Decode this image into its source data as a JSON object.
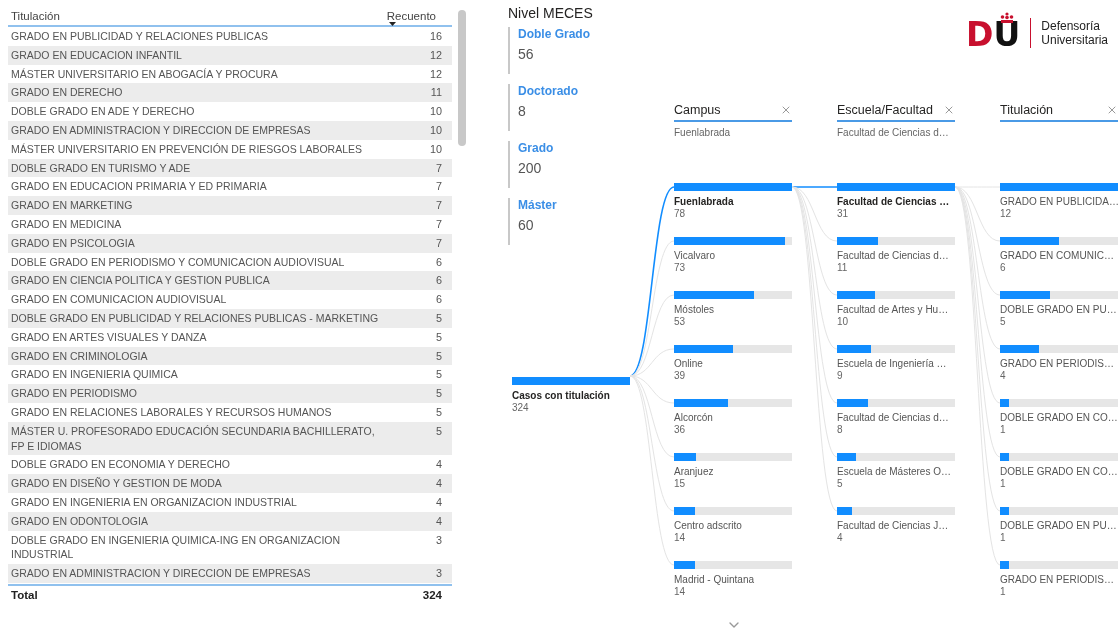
{
  "table": {
    "columns": [
      {
        "label": "Titulación",
        "sorted": false
      },
      {
        "label": "Recuento",
        "sorted": true
      }
    ],
    "rows": [
      {
        "title": "GRADO EN PUBLICIDAD Y RELACIONES PUBLICAS",
        "count": "16"
      },
      {
        "title": "GRADO EN EDUCACION INFANTIL",
        "count": "12"
      },
      {
        "title": "MÁSTER UNIVERSITARIO EN ABOGACÍA Y PROCURA",
        "count": "12"
      },
      {
        "title": "GRADO EN DERECHO",
        "count": "11"
      },
      {
        "title": "DOBLE GRADO EN ADE Y DERECHO",
        "count": "10"
      },
      {
        "title": "GRADO EN ADMINISTRACION Y DIRECCION DE EMPRESAS",
        "count": "10"
      },
      {
        "title": "MÁSTER UNIVERSITARIO EN PREVENCIÓN DE RIESGOS LABORALES",
        "count": "10"
      },
      {
        "title": "DOBLE GRADO EN TURISMO Y ADE",
        "count": "7"
      },
      {
        "title": "GRADO EN EDUCACION PRIMARIA Y ED PRIMARIA",
        "count": "7"
      },
      {
        "title": "GRADO EN MARKETING",
        "count": "7"
      },
      {
        "title": "GRADO EN MEDICINA",
        "count": "7"
      },
      {
        "title": "GRADO EN PSICOLOGIA",
        "count": "7"
      },
      {
        "title": "DOBLE GRADO EN PERIODISMO Y COMUNICACION AUDIOVISUAL",
        "count": "6"
      },
      {
        "title": "GRADO EN CIENCIA POLITICA Y GESTION PUBLICA",
        "count": "6"
      },
      {
        "title": "GRADO EN COMUNICACION AUDIOVISUAL",
        "count": "6"
      },
      {
        "title": "DOBLE GRADO EN PUBLICIDAD Y RELACIONES PUBLICAS - MARKETING",
        "count": "5"
      },
      {
        "title": "GRADO EN ARTES VISUALES Y DANZA",
        "count": "5"
      },
      {
        "title": "GRADO EN CRIMINOLOGIA",
        "count": "5"
      },
      {
        "title": "GRADO EN INGENIERIA QUIMICA",
        "count": "5"
      },
      {
        "title": "GRADO EN PERIODISMO",
        "count": "5"
      },
      {
        "title": "GRADO EN RELACIONES LABORALES Y RECURSOS HUMANOS",
        "count": "5"
      },
      {
        "title": "MÁSTER U. PROFESORADO EDUCACIÓN SECUNDARIA BACHILLERATO, FP E IDIOMAS",
        "count": "5"
      },
      {
        "title": "DOBLE GRADO EN ECONOMIA Y DERECHO",
        "count": "4"
      },
      {
        "title": "GRADO EN DISEÑO Y GESTION DE MODA",
        "count": "4"
      },
      {
        "title": "GRADO EN INGENIERIA EN ORGANIZACION INDUSTRIAL",
        "count": "4"
      },
      {
        "title": "GRADO EN ODONTOLOGIA",
        "count": "4"
      },
      {
        "title": "DOBLE GRADO EN INGENIERIA QUIMICA-ING EN ORGANIZACION INDUSTRIAL",
        "count": "3"
      },
      {
        "title": "GRADO EN ADMINISTRACION Y DIRECCION DE EMPRESAS",
        "count": "3"
      }
    ],
    "total": {
      "label": "Total",
      "value": "324"
    }
  },
  "meces": {
    "title": "Nivel MECES",
    "cards": [
      {
        "label": "Doble Grado",
        "value": "56"
      },
      {
        "label": "Doctorado",
        "value": "8"
      },
      {
        "label": "Grado",
        "value": "200"
      },
      {
        "label": "Máster",
        "value": "60"
      }
    ]
  },
  "logo": {
    "mark_left": "D",
    "mark_right": "U",
    "name_line1": "Defensoría",
    "name_line2": "Universitaria"
  },
  "tree": {
    "root": {
      "label": "Casos con titulación",
      "value": "324"
    },
    "columns": [
      {
        "header": "Campus",
        "filter": "Fuenlabrada",
        "nodes": [
          {
            "label": "Fuenlabrada",
            "value": "78",
            "level": 1,
            "selected": true
          },
          {
            "label": "Vicalvaro",
            "value": "73",
            "level": 0.94,
            "selected": false
          },
          {
            "label": "Móstoles",
            "value": "53",
            "level": 0.68,
            "selected": false
          },
          {
            "label": "Online",
            "value": "39",
            "level": 0.5,
            "selected": false
          },
          {
            "label": "Alcorcón",
            "value": "36",
            "level": 0.46,
            "selected": false
          },
          {
            "label": "Aranjuez",
            "value": "15",
            "level": 0.19,
            "selected": false
          },
          {
            "label": "Centro adscrito",
            "value": "14",
            "level": 0.18,
            "selected": false
          },
          {
            "label": "Madrid - Quintana",
            "value": "14",
            "level": 0.18,
            "selected": false
          }
        ]
      },
      {
        "header": "Escuela/Facultad",
        "filter": "Facultad de Ciencias d…",
        "nodes": [
          {
            "label": "Facultad de Ciencias …",
            "value": "31",
            "level": 1,
            "selected": true
          },
          {
            "label": "Facultad de Ciencias d…",
            "value": "11",
            "level": 0.35,
            "selected": false
          },
          {
            "label": "Facultad de Artes y Hu…",
            "value": "10",
            "level": 0.32,
            "selected": false
          },
          {
            "label": "Escuela de Ingeniería …",
            "value": "9",
            "level": 0.29,
            "selected": false
          },
          {
            "label": "Facultad de Ciencias d…",
            "value": "8",
            "level": 0.26,
            "selected": false
          },
          {
            "label": "Escuela de Másteres O…",
            "value": "5",
            "level": 0.16,
            "selected": false
          },
          {
            "label": "Facultad de Ciencias J…",
            "value": "4",
            "level": 0.13,
            "selected": false
          }
        ]
      },
      {
        "header": "Titulación",
        "nodes": [
          {
            "label": "GRADO EN PUBLICIDA…",
            "value": "12",
            "level": 1,
            "selected": false
          },
          {
            "label": "GRADO EN COMUNIC…",
            "value": "6",
            "level": 0.5,
            "selected": false
          },
          {
            "label": "DOBLE GRADO EN PU…",
            "value": "5",
            "level": 0.42,
            "selected": false
          },
          {
            "label": "GRADO EN PERIODIS…",
            "value": "4",
            "level": 0.33,
            "selected": false
          },
          {
            "label": "DOBLE GRADO EN CO…",
            "value": "1",
            "level": 0.08,
            "selected": false
          },
          {
            "label": "DOBLE GRADO EN CO…",
            "value": "1",
            "level": 0.08,
            "selected": false
          },
          {
            "label": "DOBLE GRADO EN PU…",
            "value": "1",
            "level": 0.08,
            "selected": false
          },
          {
            "label": "GRADO EN PERIODIS…",
            "value": "1",
            "level": 0.08,
            "selected": false
          }
        ]
      }
    ]
  }
}
